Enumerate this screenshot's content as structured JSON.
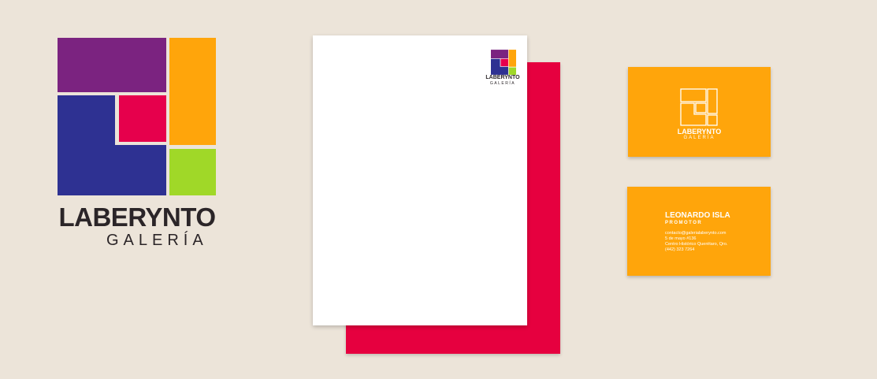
{
  "brand": {
    "name": "LABERYNTO",
    "subtitle": "GALERÍA"
  },
  "colors": {
    "background": "#ece4d9",
    "purple": "#7b2380",
    "blue": "#2e3192",
    "magenta": "#e6004c",
    "orange": "#ffa50b",
    "green": "#a0d828",
    "red_sheet": "#e6003f",
    "ink": "#2b2528"
  },
  "business_card_front": {
    "icon": "laberynto-outline-icon",
    "name": "LABERYNTO",
    "subtitle": "GALERÍA"
  },
  "business_card_back": {
    "person_name": "LEONARDO ISLA",
    "role": "PROMOTOR",
    "email": "contacto@galerialaberynto.com",
    "address_line1": "5 de mayo #136",
    "address_line2": "Centro Histórico Querétaro, Qro.",
    "phone": "(442) 323 7264"
  }
}
